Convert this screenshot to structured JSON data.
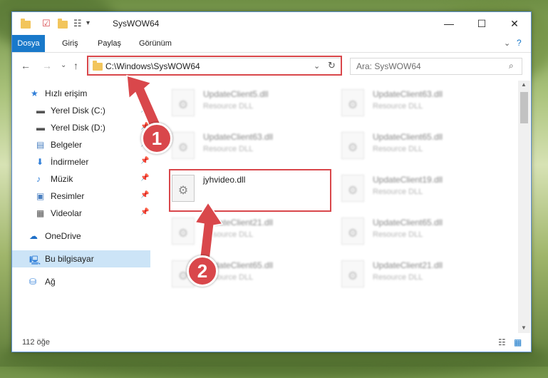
{
  "window": {
    "title": "SysWOW64"
  },
  "ribbon": {
    "tabs": [
      "Dosya",
      "Giriş",
      "Paylaş",
      "Görünüm"
    ]
  },
  "address": {
    "path": "C:\\Windows\\SysWOW64"
  },
  "search": {
    "placeholder": "Ara: SysWOW64"
  },
  "sidebar": {
    "items": [
      {
        "label": "Hızlı erişim",
        "icon": "star-icon"
      },
      {
        "label": "Yerel Disk (C:)",
        "icon": "drive-icon"
      },
      {
        "label": "Yerel Disk (D:)",
        "icon": "drive-icon"
      },
      {
        "label": "Belgeler",
        "icon": "documents-icon"
      },
      {
        "label": "İndirmeler",
        "icon": "download-icon"
      },
      {
        "label": "Müzik",
        "icon": "music-icon"
      },
      {
        "label": "Resimler",
        "icon": "pictures-icon"
      },
      {
        "label": "Videolar",
        "icon": "videos-icon"
      },
      {
        "label": "OneDrive",
        "icon": "cloud-icon"
      },
      {
        "label": "Bu bilgisayar",
        "icon": "computer-icon"
      },
      {
        "label": "Ağ",
        "icon": "network-icon"
      }
    ]
  },
  "files": [
    {
      "name": "UpdateClient5.dll",
      "type": "Resource DLL"
    },
    {
      "name": "UpdateClient63.dll",
      "type": "Resource DLL"
    },
    {
      "name": "UpdateClient63.dll",
      "type": "Resource DLL"
    },
    {
      "name": "UpdateClient65.dll",
      "type": "Resource DLL"
    },
    {
      "name": "jyhvideo.dll",
      "type": ""
    },
    {
      "name": "UpdateClient19.dll",
      "type": "Resource DLL"
    },
    {
      "name": "UpdateClient21.dll",
      "type": "Resource DLL"
    },
    {
      "name": "UpdateClient65.dll",
      "type": "Resource DLL"
    },
    {
      "name": "UpdateClient65.dll",
      "type": "Resource DLL"
    },
    {
      "name": "UpdateClient21.dll",
      "type": "Resource DLL"
    }
  ],
  "status": {
    "count": "112 öğe"
  },
  "markers": {
    "one": "1",
    "two": "2"
  },
  "colors": {
    "accent": "#1979ca",
    "highlight": "#d9474b"
  }
}
